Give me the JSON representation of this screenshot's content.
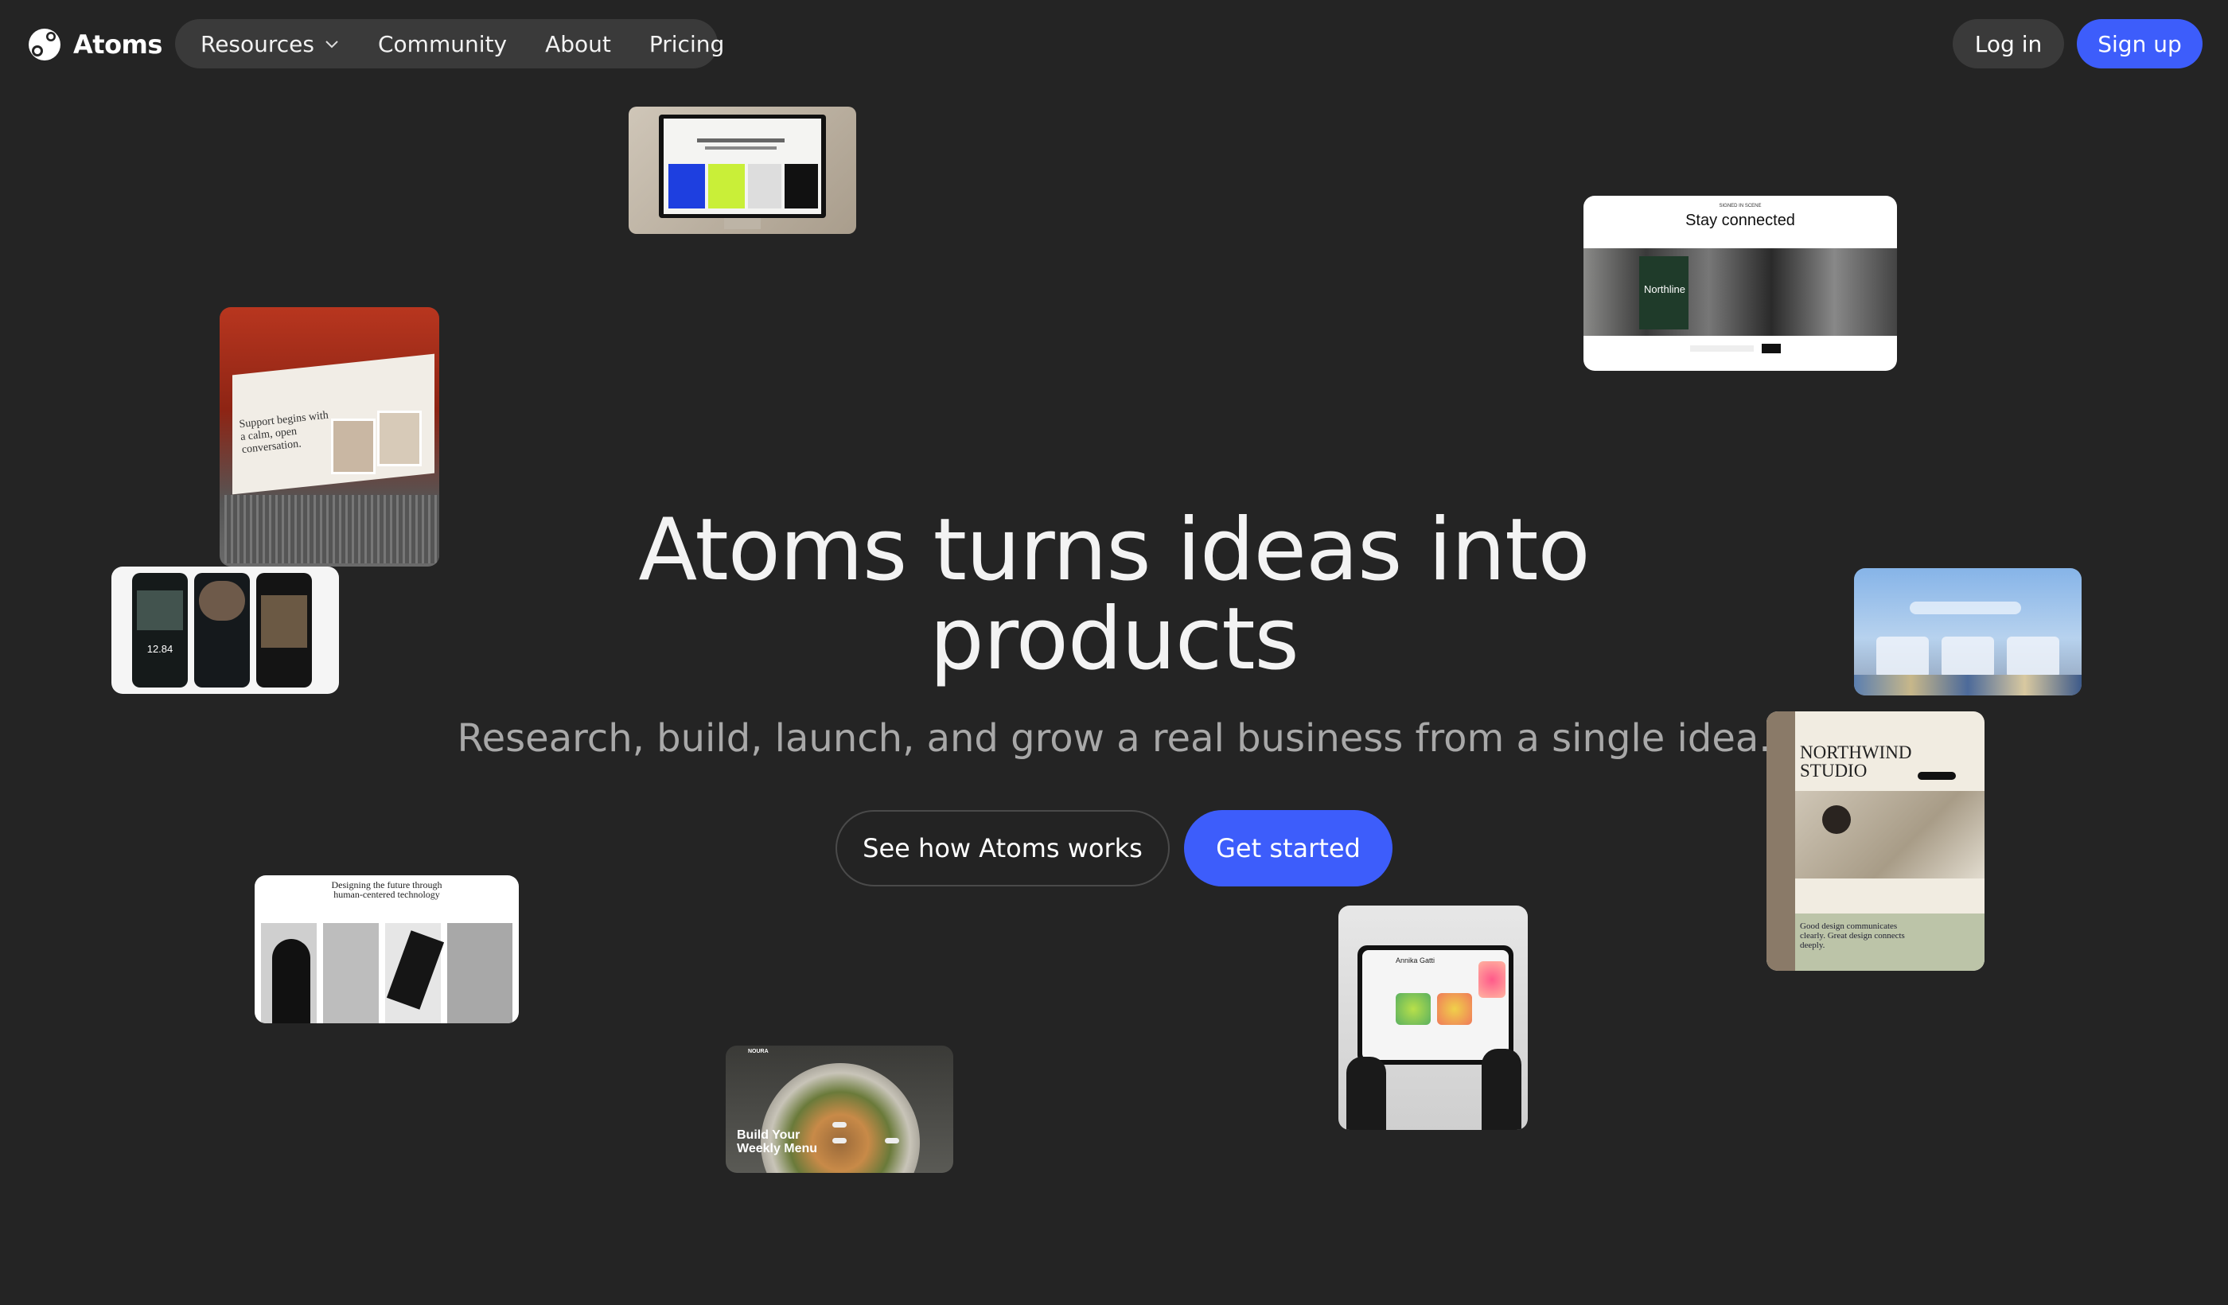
{
  "brand": {
    "name": "Atoms"
  },
  "nav": {
    "items": [
      {
        "label": "Resources",
        "has_dropdown": true
      },
      {
        "label": "Community"
      },
      {
        "label": "About"
      },
      {
        "label": "Pricing"
      }
    ],
    "login_label": "Log in",
    "signup_label": "Sign up"
  },
  "hero": {
    "title_line1": "Atoms turns ideas into",
    "title_line2": "products",
    "subtitle": "Research, build, launch, and grow a real business from a single idea.",
    "secondary_cta": "See how Atoms works",
    "primary_cta": "Get started"
  },
  "showcase": {
    "stay_connected": {
      "eyebrow": "SIGNED IN SCENE",
      "title": "Stay connected",
      "brand": "Northline"
    },
    "support_laptop": {
      "headline": "Support begins with a calm, open conversation."
    },
    "phones": {
      "stat": "12.84"
    },
    "northwind": {
      "title_line1": "NORTHWIND",
      "title_line2": "STUDIO",
      "tagline": "Good design communicates clearly. Great design connects deeply."
    },
    "future_tech": {
      "title_line1": "Designing the future through",
      "title_line2": "human-centered technology"
    },
    "weekly_menu": {
      "brand": "NOURA",
      "title_line1": "Build Your",
      "title_line2": "Weekly Menu"
    },
    "tablet": {
      "greeting": "Annika Gatti"
    }
  },
  "colors": {
    "background": "#242424",
    "accent": "#3d5dfb",
    "pill": "#3a3a3a"
  }
}
